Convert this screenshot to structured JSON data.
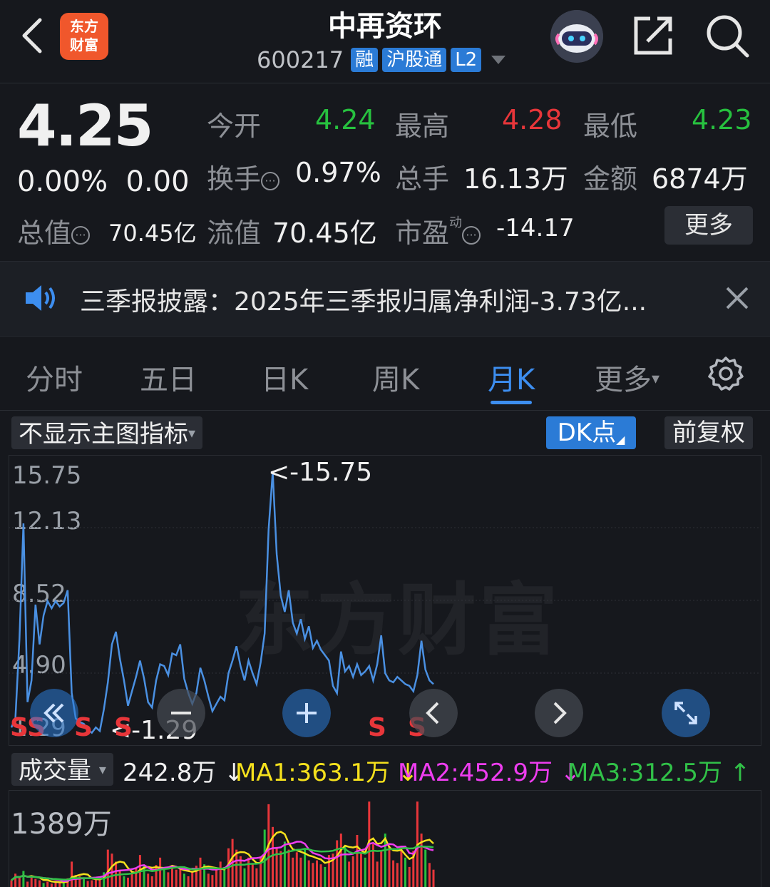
{
  "header": {
    "title": "中再资环",
    "code": "600217",
    "tags": [
      "融",
      "沪股通",
      "L2"
    ],
    "logo_text": "东方财富"
  },
  "quote": {
    "price": "4.25",
    "change_pct": "0.00%",
    "change_abs": "0.00",
    "open_label": "今开",
    "open": "4.24",
    "high_label": "最高",
    "high": "4.28",
    "low_label": "最低",
    "low": "4.23",
    "turnover_label": "换手",
    "turnover": "0.97%",
    "volume_label": "总手",
    "volume": "16.13万",
    "amount_label": "金额",
    "amount": "6874万",
    "total_cap_label": "总值",
    "total_cap": "70.45亿",
    "float_cap_label": "流值",
    "float_cap": "70.45亿",
    "pe_label": "市盈",
    "pe_super": "动",
    "pe": "-14.17",
    "more": "更多",
    "colors": {
      "up": "#e8363a",
      "down": "#27c13f"
    }
  },
  "notice": {
    "text": "三季报披露：2025年三季报归属净利润-3.73亿..."
  },
  "tabs": [
    "分时",
    "五日",
    "日K",
    "周K",
    "月K",
    "更多"
  ],
  "active_tab": "月K",
  "toolbar": {
    "indicator": "不显示主图指标",
    "dk": "DK点",
    "adjust": "前复权"
  },
  "chart_data": {
    "type": "line",
    "y_ticks": [
      "15.75",
      "12.13",
      "8.52",
      "4.90",
      "1.29"
    ],
    "max_label": "<-15.75",
    "min_label": "<-1.29",
    "signals": [
      "S",
      "S",
      "S",
      "S",
      "S",
      "S"
    ],
    "ylim": [
      1.29,
      15.75
    ],
    "watermark": "东方财富",
    "values": [
      1.6,
      2.1,
      6.5,
      12.9,
      3.0,
      4.2,
      8.4,
      6.2,
      7.8,
      8.6,
      8.2,
      8.6,
      8.3,
      8.5,
      9.2,
      3.5,
      2.1,
      1.9,
      1.8,
      1.5,
      1.3,
      1.6,
      1.4,
      2.6,
      4.1,
      6.2,
      6.9,
      5.4,
      4.2,
      2.8,
      3.6,
      4.4,
      5.3,
      4.3,
      3.0,
      2.7,
      4.2,
      5.1,
      5.0,
      4.5,
      5.7,
      5.6,
      6.2,
      4.3,
      3.5,
      2.9,
      3.5,
      4.9,
      4.2,
      3.3,
      2.5,
      2.9,
      3.3,
      3.1,
      4.6,
      5.3,
      6.1,
      5.0,
      4.2,
      5.3,
      4.6,
      4.0,
      5.2,
      6.8,
      12.6,
      15.75,
      11.2,
      8.9,
      8.0,
      9.2,
      7.4,
      6.8,
      7.6,
      6.5,
      7.2,
      6.0,
      6.4,
      5.9,
      5.6,
      5.3,
      3.9,
      3.5,
      5.8,
      4.7,
      5.0,
      4.4,
      5.1,
      4.5,
      4.7,
      5.0,
      4.2,
      5.1,
      6.7,
      4.6,
      4.2,
      4.1,
      4.4,
      4.2,
      4.0,
      3.9,
      3.6,
      4.5,
      6.4,
      4.8,
      4.2,
      4.0
    ]
  },
  "volume": {
    "selector": "成交量",
    "current": "242.8万",
    "current_arrow": "↓",
    "ma1": "MA1:363.1万",
    "ma1_arrow": "↓",
    "ma2": "MA2:452.9万",
    "ma2_arrow": "↓",
    "ma3": "MA3:312.5万",
    "ma3_arrow": "↑",
    "max_label": "1389万",
    "colors": {
      "ma1": "#f5e11d",
      "ma2": "#ee3df0",
      "ma3": "#31c148"
    },
    "bars": [
      1.0,
      2.0,
      1.5,
      2.4,
      0.8,
      1.6,
      1.2,
      1.0,
      0.6,
      0.8,
      0.5,
      0.9,
      0.7,
      0.6,
      1.3,
      3.8,
      1.8,
      1.6,
      1.2,
      0.9,
      1.0,
      1.2,
      1.4,
      2.2,
      5.6,
      5.0,
      3.8,
      2.4,
      1.6,
      1.4,
      2.2,
      2.8,
      4.8,
      3.2,
      2.0,
      1.6,
      3.3,
      4.4,
      3.0,
      2.2,
      3.0,
      2.6,
      2.8,
      2.0,
      1.6,
      2.4,
      3.2,
      4.4,
      3.4,
      2.0,
      1.8,
      2.6,
      3.8,
      3.0,
      5.8,
      7.2,
      5.6,
      4.6,
      2.8,
      4.4,
      3.4,
      2.8,
      4.6,
      8.6,
      12.4,
      9.0,
      6.0,
      5.4,
      6.8,
      5.6,
      4.4,
      5.2,
      4.4,
      5.6,
      4.0,
      3.6,
      4.0,
      3.4,
      3.0,
      4.8,
      5.0,
      7.0,
      8.0,
      6.2,
      3.8,
      4.6,
      7.8,
      5.0,
      4.4,
      12.8,
      6.4,
      3.8,
      5.4,
      8.0,
      6.2,
      4.0,
      3.6,
      6.0,
      4.4,
      3.0,
      5.4,
      12.8,
      8.0,
      5.6,
      3.6,
      2.6
    ]
  }
}
